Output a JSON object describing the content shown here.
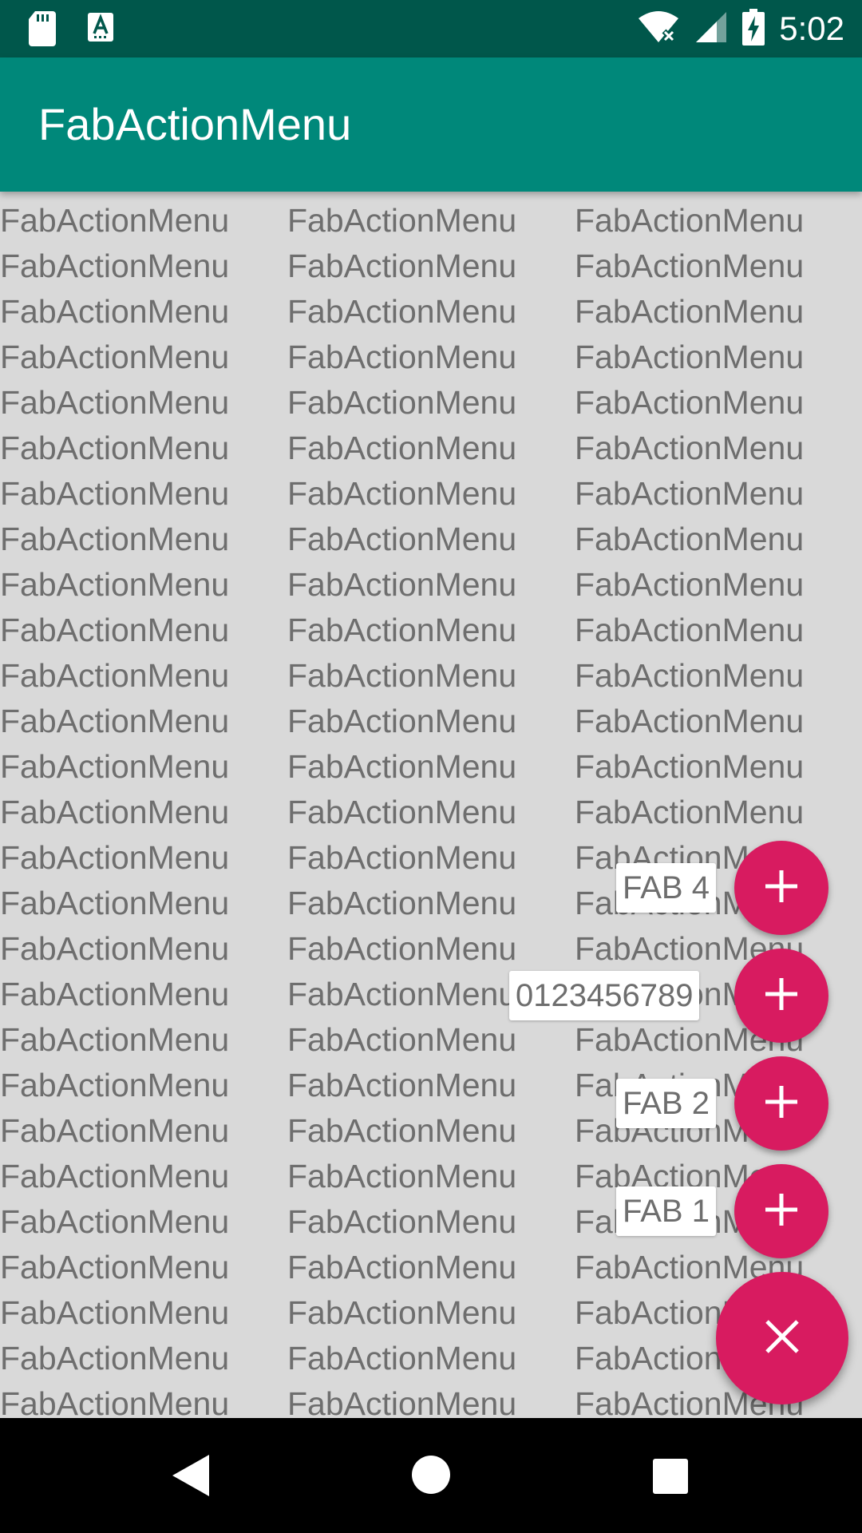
{
  "status_bar": {
    "time": "5:02",
    "left_icons": [
      "sd-card-icon",
      "text-input-notification-icon"
    ],
    "right_icons": [
      "wifi-off-icon",
      "cell-signal-icon",
      "battery-charging-icon"
    ]
  },
  "app_bar": {
    "title": "FabActionMenu"
  },
  "content": {
    "cell_text": "FabActionMenu",
    "columns": 3,
    "rows": 27
  },
  "fab_menu": {
    "items": [
      {
        "label": "FAB 4",
        "icon": "plus-icon"
      },
      {
        "label": "0123456789",
        "icon": "plus-icon"
      },
      {
        "label": "FAB 2",
        "icon": "plus-icon"
      },
      {
        "label": "FAB 1",
        "icon": "plus-icon"
      }
    ],
    "main_icon": "close-icon",
    "fab_color": "#d81b60"
  },
  "nav_bar": {
    "buttons": [
      "back-icon",
      "home-icon",
      "recents-icon"
    ]
  },
  "colors": {
    "status_bar": "#00574b",
    "app_bar": "#00887a",
    "background": "#d9d9d9",
    "accent": "#d81b60"
  }
}
